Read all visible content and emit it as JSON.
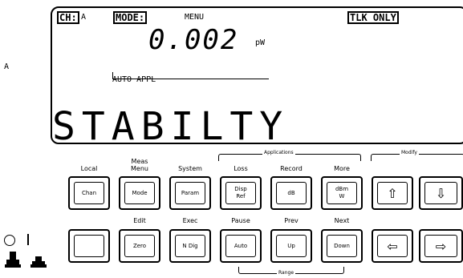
{
  "display": {
    "ch_tag": "CH:",
    "ch_value": "A",
    "mode_tag": "MODE:",
    "mode_value": "MENU",
    "talk_tag": "TLK ONLY",
    "side_label": "A",
    "reading": "0.002",
    "unit": "pW",
    "application": "AUTO APPL",
    "main_text": "STABILTY"
  },
  "groups": {
    "applications": "Applications",
    "modify": "Modify",
    "range": "Range"
  },
  "keys_top": [
    {
      "above": "Local",
      "label": "Chan"
    },
    {
      "above": "Meas\nMenu",
      "label": "Mode"
    },
    {
      "above": "System",
      "label": "Param"
    },
    {
      "above": "Loss",
      "label": "Disp\nRef"
    },
    {
      "above": "Record",
      "label": "dB"
    },
    {
      "above": "More",
      "label": "dBm\nW"
    },
    {
      "above": "",
      "label": "⇧"
    },
    {
      "above": "",
      "label": "⇩"
    }
  ],
  "keys_bottom": [
    {
      "above": "",
      "label": ""
    },
    {
      "above": "Edit",
      "label": "Zero"
    },
    {
      "above": "Exec",
      "label": "N Dig"
    },
    {
      "above": "Pause",
      "label": "Auto"
    },
    {
      "above": "Prev",
      "label": "Up"
    },
    {
      "above": "Next",
      "label": "Down"
    },
    {
      "above": "",
      "label": "⇦"
    },
    {
      "above": "",
      "label": "⇨"
    }
  ]
}
